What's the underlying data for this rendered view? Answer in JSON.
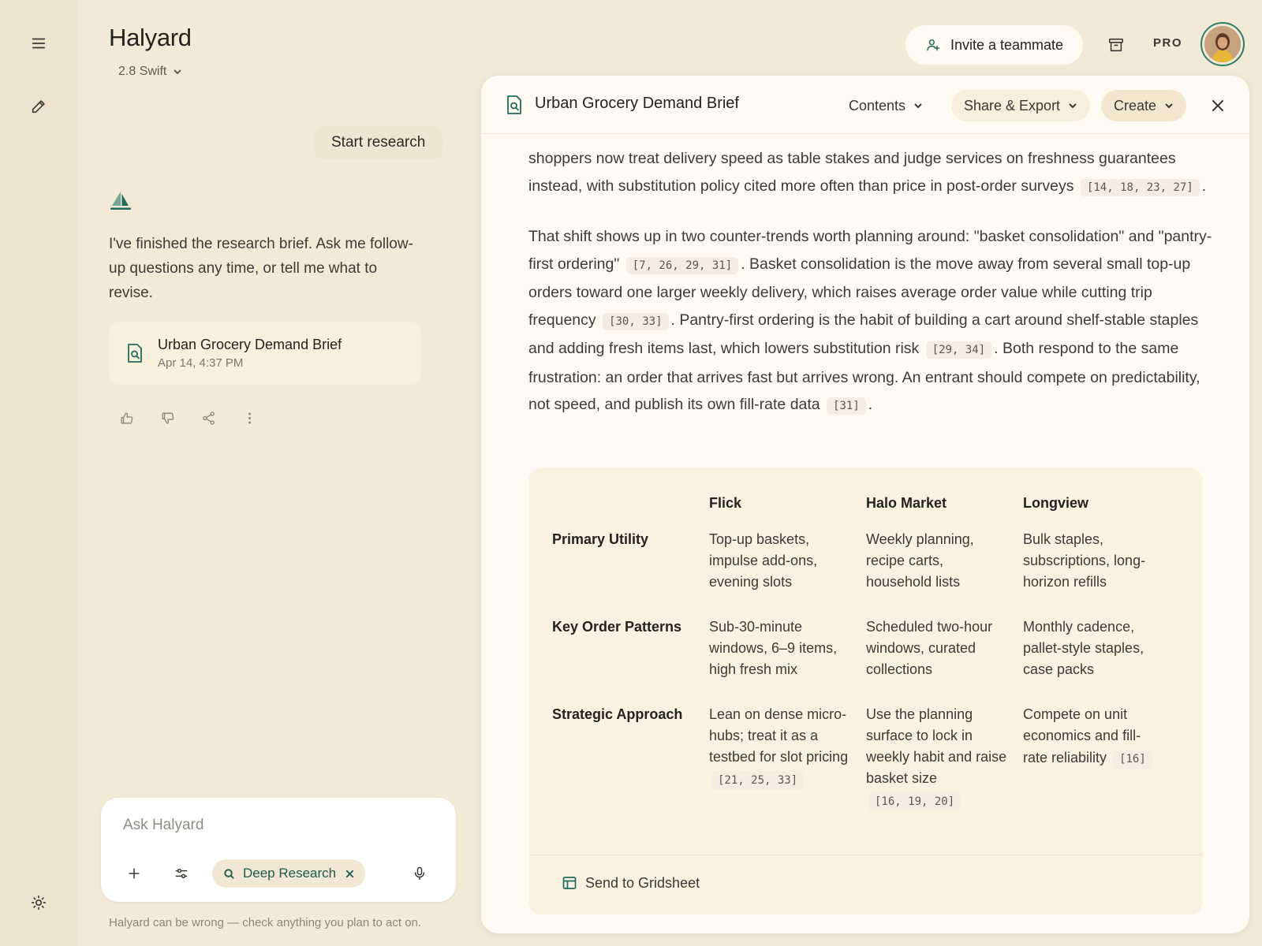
{
  "app": {
    "title": "Halyard",
    "model": "2.8 Swift"
  },
  "chat": {
    "user_message": "Start research",
    "assistant_message": "I've finished the research brief. Ask me follow-up questions any time, or tell me what to revise.",
    "doc_card": {
      "title": "Urban Grocery Demand Brief",
      "timestamp": "Apr 14, 4:37 PM"
    }
  },
  "composer": {
    "placeholder": "Ask Halyard",
    "mode_label": "Deep Research",
    "disclaimer": "Halyard can be wrong — check anything you plan to act on."
  },
  "topbar": {
    "invite_label": "Invite a teammate",
    "plan_badge": "PRO"
  },
  "panel": {
    "title": "Urban Grocery Demand Brief",
    "contents_label": "Contents",
    "share_label": "Share & Export",
    "create_label": "Create",
    "p1": {
      "text": "shoppers now treat delivery speed as table stakes and judge services on freshness guarantees instead, with substitution policy cited more often than price in post-order surveys",
      "cite": "[14, 18, 23, 27]"
    },
    "p2": {
      "t1": "That shift shows up in two counter-trends worth planning around: \"basket consolidation\" and \"pantry-first ordering\"",
      "c1": "[7, 26, 29, 31]",
      "t2": ". Basket consolidation is the move away from several small top-up orders toward one larger weekly delivery, which raises average order value while cutting trip frequency",
      "c2": "[30, 33]",
      "t3": ". Pantry-first ordering is the habit of building a cart around shelf-stable staples and adding fresh items last, which lowers substitution risk",
      "c3": "[29, 34]",
      "t4": ". Both respond to the same frustration: an order that arrives fast but arrives wrong. An entrant should compete on predictability, not speed, and publish its own fill-rate data",
      "c4": "[31]"
    },
    "table": {
      "columns": [
        "Flick",
        "Halo Market",
        "Longview"
      ],
      "rows": [
        {
          "label": "Primary Utility",
          "cells": [
            {
              "text": "Top-up baskets, impulse add-ons, evening slots"
            },
            {
              "text": "Weekly planning, recipe carts, household lists"
            },
            {
              "text": "Bulk staples, subscriptions, long-horizon refills"
            }
          ]
        },
        {
          "label": "Key Order Patterns",
          "cells": [
            {
              "text": "Sub-30-minute windows, 6–9 items, high fresh mix"
            },
            {
              "text": "Scheduled two-hour windows, curated collections"
            },
            {
              "text": "Monthly cadence, pallet-style staples, case packs"
            }
          ]
        },
        {
          "label": "Strategic Approach",
          "cells": [
            {
              "text": "Lean on dense micro-hubs; treat it as a testbed for slot pricing",
              "cite": "[21, 25, 33]"
            },
            {
              "text": "Use the planning surface to lock in weekly habit and raise basket size",
              "cite": "[16, 19, 20]"
            },
            {
              "text": "Compete on unit economics and fill-rate reliability",
              "cite": "[16]"
            }
          ]
        }
      ]
    },
    "gridsheet_label": "Send to Gridsheet"
  },
  "colors": {
    "accent": "#1f6b5c",
    "background": "#f2e9d6",
    "panel": "#fffbf3",
    "card": "#faf1e1"
  }
}
